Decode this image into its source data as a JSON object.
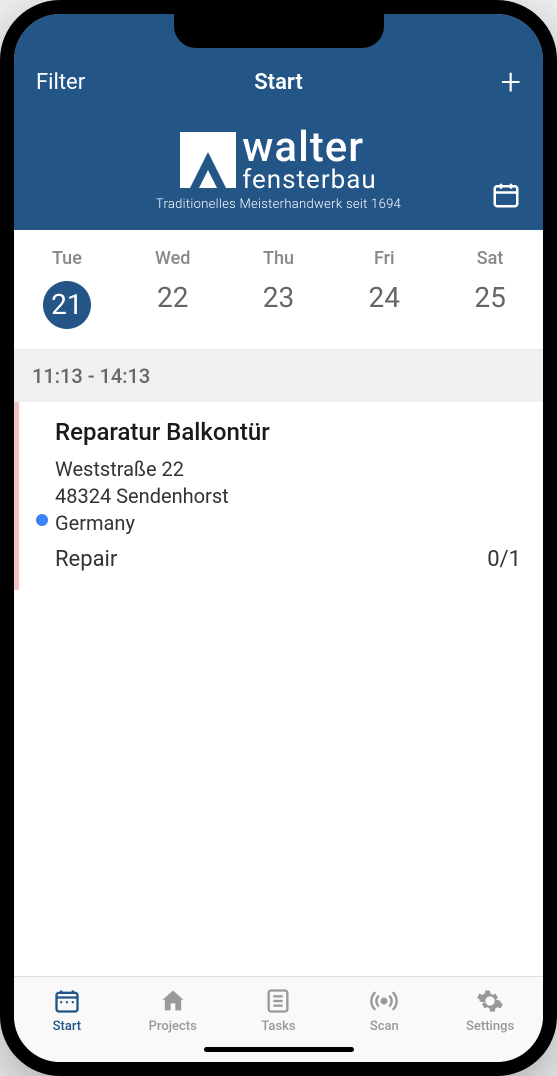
{
  "header": {
    "filter_label": "Filter",
    "title": "Start"
  },
  "logo": {
    "primary": "walter",
    "secondary": "fensterbau",
    "tagline": "Traditionelles Meisterhandwerk seit 1694"
  },
  "dates": [
    {
      "day": "Tue",
      "num": "21",
      "active": true
    },
    {
      "day": "Wed",
      "num": "22",
      "active": false
    },
    {
      "day": "Thu",
      "num": "23",
      "active": false
    },
    {
      "day": "Fri",
      "num": "24",
      "active": false
    },
    {
      "day": "Sat",
      "num": "25",
      "active": false
    }
  ],
  "schedule": {
    "time_header": "11:13 - 14:13",
    "appointment": {
      "title": "Reparatur Balkontür",
      "address_line1": "Weststraße 22",
      "address_line2": "48324 Sendenhorst",
      "address_line3": "Germany",
      "type": "Repair",
      "progress": "0/1"
    }
  },
  "tabs": [
    {
      "label": "Start",
      "icon": "calendar-icon",
      "active": true
    },
    {
      "label": "Projects",
      "icon": "house-icon",
      "active": false
    },
    {
      "label": "Tasks",
      "icon": "checklist-icon",
      "active": false
    },
    {
      "label": "Scan",
      "icon": "scan-icon",
      "active": false
    },
    {
      "label": "Settings",
      "icon": "gear-icon",
      "active": false
    }
  ]
}
